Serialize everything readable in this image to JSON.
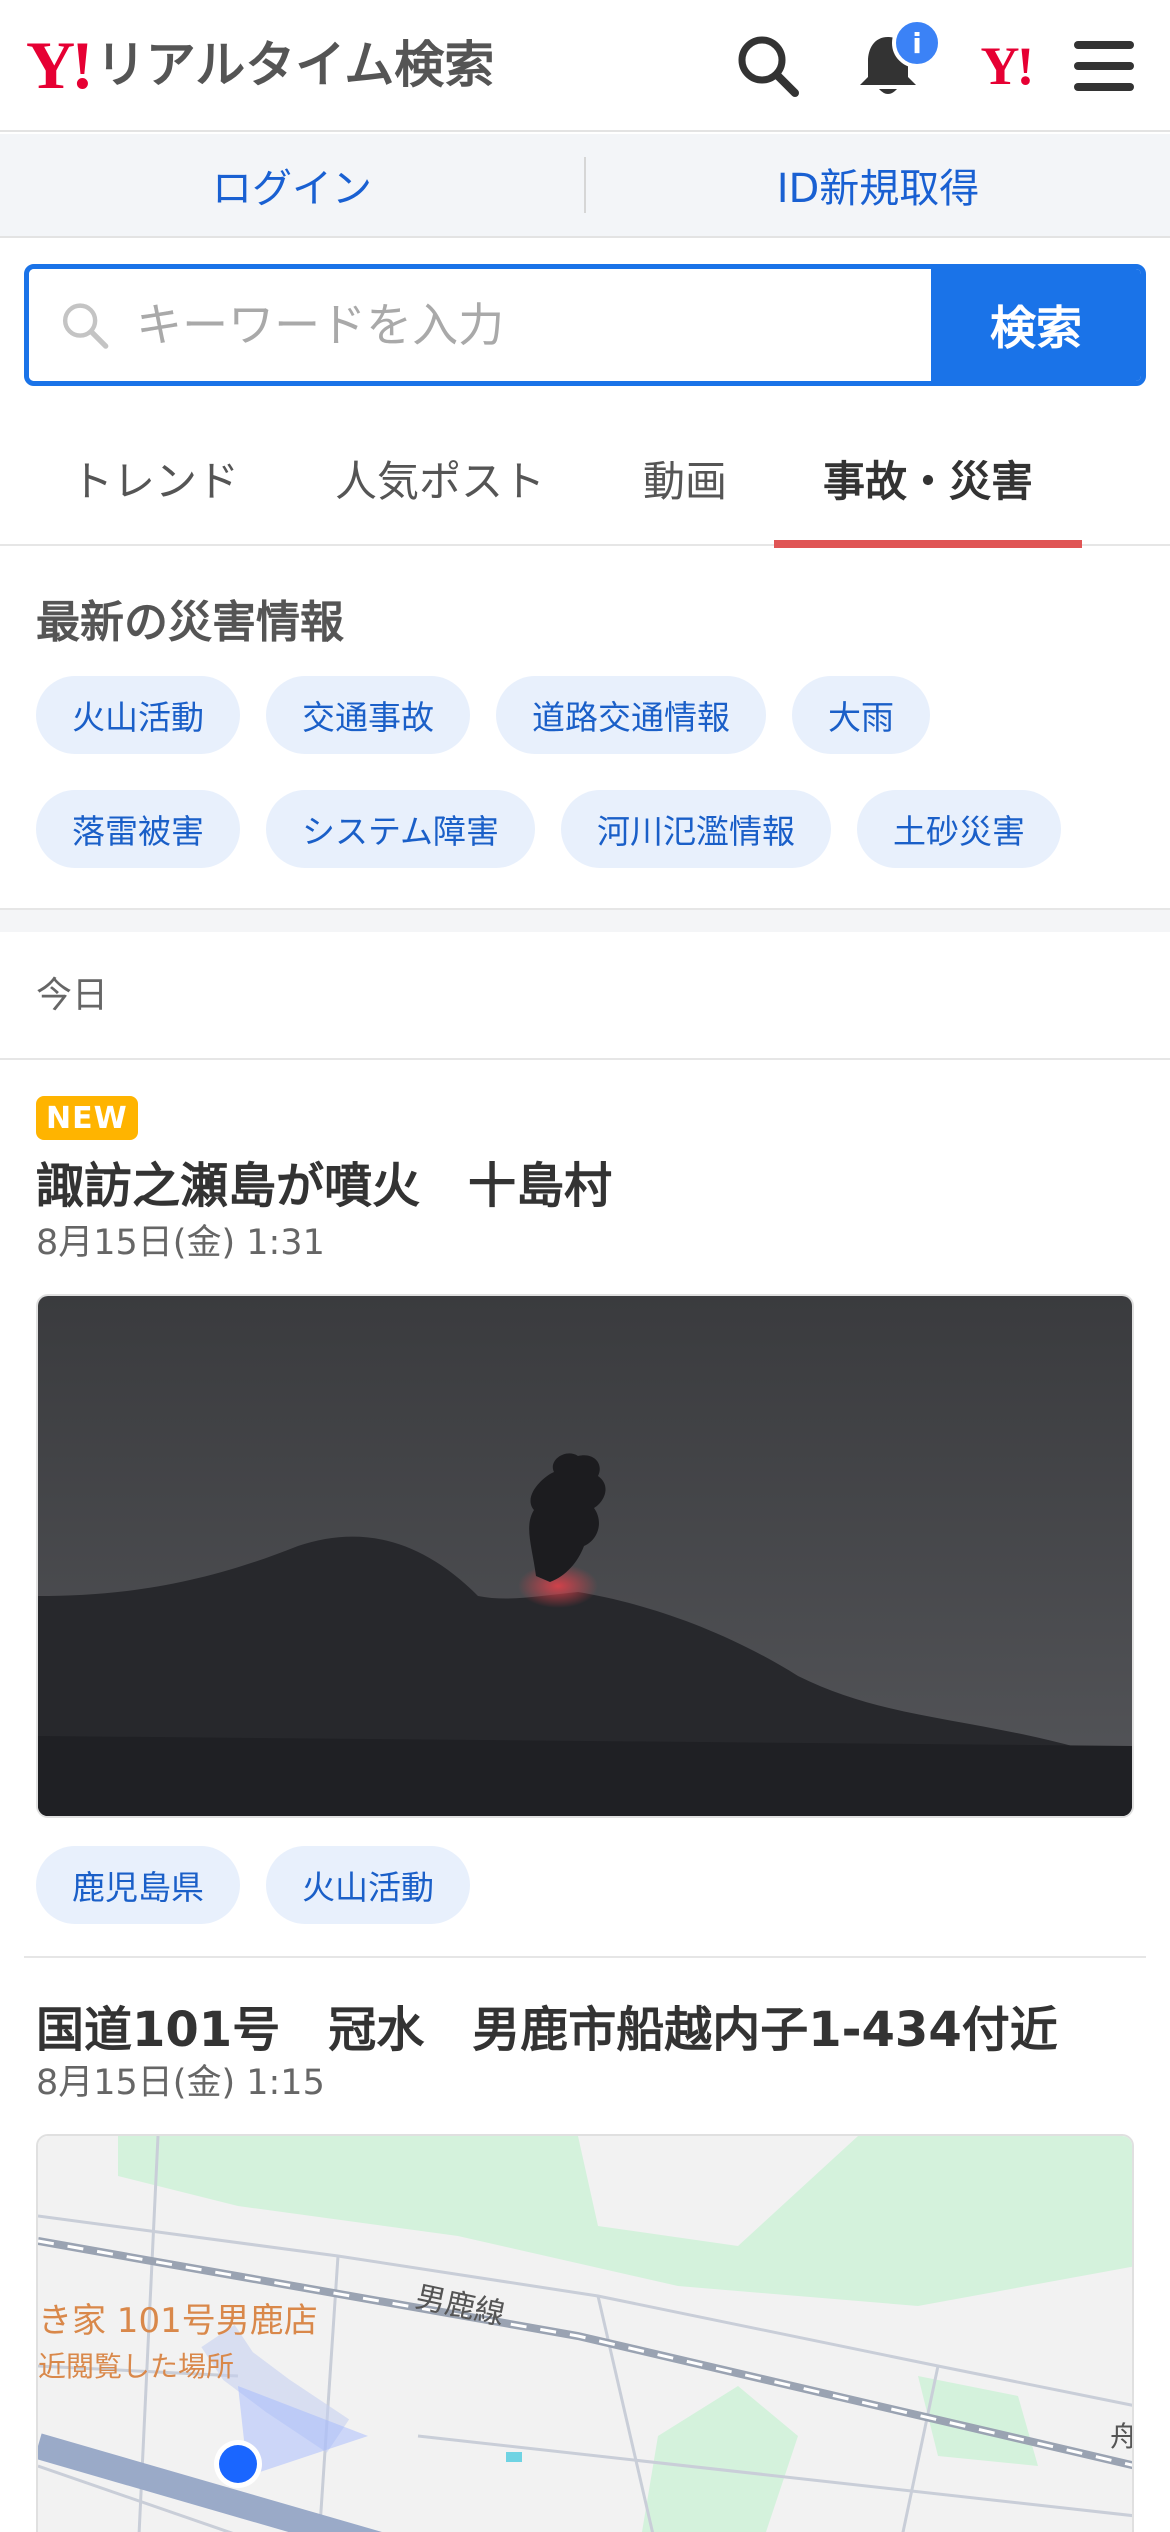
{
  "header": {
    "logo_mark": "Y!",
    "logo_text": "リアルタイム検索",
    "notification_badge": "i",
    "yahoo_mark": "Y!"
  },
  "login_bar": {
    "login_label": "ログイン",
    "signup_label": "ID新規取得"
  },
  "search": {
    "placeholder": "キーワードを入力",
    "button_label": "検索"
  },
  "tabs": [
    {
      "label": "トレンド",
      "active": false
    },
    {
      "label": "人気ポスト",
      "active": false
    },
    {
      "label": "動画",
      "active": false
    },
    {
      "label": "事故・災害",
      "active": true
    }
  ],
  "disaster_info": {
    "title": "最新の災害情報",
    "chips_row1": [
      "火山活動",
      "交通事故",
      "道路交通情報",
      "大雨"
    ],
    "chips_row2": [
      "落雷被害",
      "システム障害",
      "河川氾濫情報",
      "土砂災害"
    ]
  },
  "timeline": {
    "section_label": "今日"
  },
  "articles": [
    {
      "badge": "NEW",
      "title": "諏訪之瀬島が噴火　十島村",
      "date": "8月15日(金) 1:31",
      "tags": [
        "鹿児島県",
        "火山活動"
      ]
    },
    {
      "title": "国道101号　冠水　男鹿市船越内子1-434付近",
      "date": "8月15日(金) 1:15",
      "map_labels": {
        "railway": "男鹿線",
        "store": "き家 101号男鹿店",
        "recent": "近閲覧した場所",
        "edge": "舟"
      }
    }
  ],
  "colors": {
    "brand_red": "#e60033",
    "accent_blue": "#1a73e8",
    "active_tab_underline": "#e05555",
    "chip_bg": "#e8f0fc",
    "new_badge": "#ffb400"
  }
}
